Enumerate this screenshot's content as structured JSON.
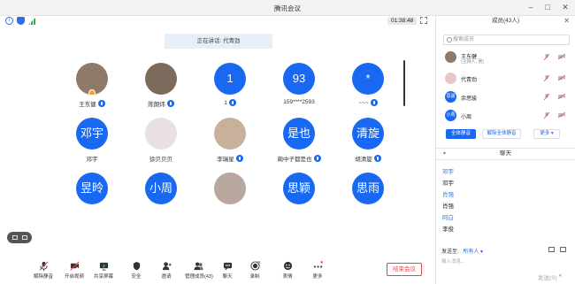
{
  "window": {
    "title": "腾讯会议"
  },
  "meeting": {
    "timer": "01:38:48",
    "speaking": "正在讲话: 代青劲"
  },
  "participants": [
    {
      "name": "王东健",
      "kind": "photo",
      "color": "#8d7a6a",
      "host": true,
      "mic": true
    },
    {
      "name": "陈朗炜",
      "kind": "photo",
      "color": "#7a6b5d",
      "mic": true
    },
    {
      "name": "1",
      "kind": "text",
      "initial": "1",
      "mic": true
    },
    {
      "name": "159****2593",
      "kind": "text",
      "initial": "93",
      "mic": false
    },
    {
      "name": "~~~",
      "kind": "text",
      "initial": "*",
      "mic": true
    },
    {
      "name": "邓宇",
      "kind": "text",
      "initial": "邓宇",
      "mic": false
    },
    {
      "name": "徐贝贝贝",
      "kind": "photo",
      "color": "#e9dfe5",
      "mic": false
    },
    {
      "name": "李瑞星",
      "kind": "photo",
      "color": "#c9b09a",
      "mic": true
    },
    {
      "name": "蔺中子都是也",
      "kind": "text",
      "initial": "是也",
      "mic": true
    },
    {
      "name": "胡清旋",
      "kind": "text",
      "initial": "清旋",
      "mic": true
    },
    {
      "name": "",
      "kind": "text",
      "initial": "昱昤",
      "mic": false
    },
    {
      "name": "",
      "kind": "text",
      "initial": "小周",
      "mic": false
    },
    {
      "name": "",
      "kind": "photo",
      "color": "#b8a79d",
      "mic": false
    },
    {
      "name": "",
      "kind": "text",
      "initial": "思颖",
      "mic": false
    },
    {
      "name": "",
      "kind": "text",
      "initial": "思雨",
      "mic": false
    }
  ],
  "toolbar": [
    {
      "label": "解除静音",
      "icon": "mic-muted-icon"
    },
    {
      "label": "开启视频",
      "icon": "video-off-icon"
    },
    {
      "label": "共享屏幕",
      "icon": "share-screen-icon"
    },
    {
      "label": "安全",
      "icon": "shield-icon"
    },
    {
      "label": "邀请",
      "icon": "invite-icon"
    },
    {
      "label": "管理成员(43)",
      "icon": "members-icon"
    },
    {
      "label": "聊天",
      "icon": "chat-icon"
    },
    {
      "label": "录制",
      "icon": "record-icon"
    },
    {
      "label": "表情",
      "icon": "emoji-icon"
    },
    {
      "label": "更多",
      "icon": "more-icon"
    }
  ],
  "end_button": "结束会议",
  "members_panel": {
    "title": "成员(43人)",
    "search_placeholder": "搜索成员",
    "members": [
      {
        "name": "王东健",
        "role": "(主持人, 我)",
        "avatar": "photo",
        "color": "#8d7a6a"
      },
      {
        "name": "代青劲",
        "role": "",
        "avatar": "photo",
        "color": "#e9c7c7"
      },
      {
        "name": "余思骏",
        "role": "",
        "avatar": "text",
        "initial": "思骏",
        "color": "#1868f2"
      },
      {
        "name": "小周",
        "role": "",
        "avatar": "text",
        "initial": "小周",
        "color": "#1868f2"
      }
    ],
    "mute_all": "全体静音",
    "unmute_all": "解除全体静音",
    "more": "更多"
  },
  "chat": {
    "title": "聊天",
    "lines": [
      {
        "type": "sender",
        "text": "邓宇"
      },
      {
        "type": "msg",
        "text": "邓宇"
      },
      {
        "type": "sender",
        "text": "肖强"
      },
      {
        "type": "msg",
        "text": "肖强"
      },
      {
        "type": "sender",
        "text": "阿白"
      },
      {
        "type": "msg",
        "text": "李俊"
      }
    ],
    "send_to_label": "发送至:",
    "send_to_target": "所有人",
    "input_placeholder": "输入消息...",
    "send": "发送(S)"
  },
  "colors": {
    "accent": "#1868f2",
    "danger": "#e8453c",
    "host": "#f7a22a"
  }
}
